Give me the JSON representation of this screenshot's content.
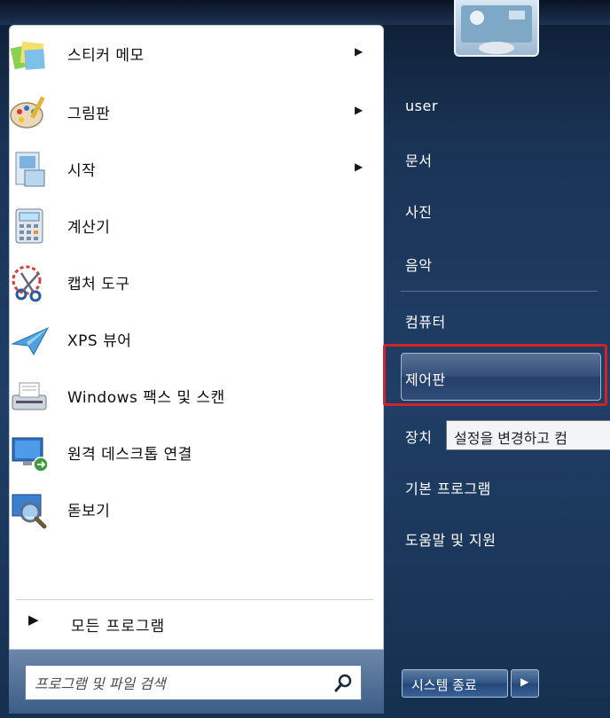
{
  "programs": [
    {
      "label": "스티커 메모",
      "icon": "sticky-notes-icon",
      "submenu": true
    },
    {
      "label": "그림판",
      "icon": "paint-icon",
      "submenu": true
    },
    {
      "label": "시작",
      "icon": "getting-started-icon",
      "submenu": true
    },
    {
      "label": "계산기",
      "icon": "calculator-icon",
      "submenu": false
    },
    {
      "label": "캡처 도구",
      "icon": "snipping-tool-icon",
      "submenu": false
    },
    {
      "label": "XPS 뷰어",
      "icon": "xps-viewer-icon",
      "submenu": false
    },
    {
      "label": "Windows 팩스 및 스캔",
      "icon": "fax-scan-icon",
      "submenu": false
    },
    {
      "label": "원격 데스크톱 연결",
      "icon": "remote-desktop-icon",
      "submenu": false
    },
    {
      "label": "돋보기",
      "icon": "magnifier-icon",
      "submenu": false
    }
  ],
  "all_programs": {
    "label": "모든 프로그램"
  },
  "search": {
    "placeholder": "프로그램 및 파일 검색"
  },
  "right_panel": {
    "user": "user",
    "documents": "문서",
    "pictures": "사진",
    "music": "음악",
    "computer": "컴퓨터",
    "control_panel": "제어판",
    "devices": "장치",
    "default_programs": "기본 프로그램",
    "help": "도움말 및 지원"
  },
  "tooltip": "설정을 변경하고 컴",
  "shutdown": {
    "label": "시스템 종료"
  },
  "colors": {
    "highlight_border": "#d3232a",
    "panel_blue": "#203e66"
  }
}
